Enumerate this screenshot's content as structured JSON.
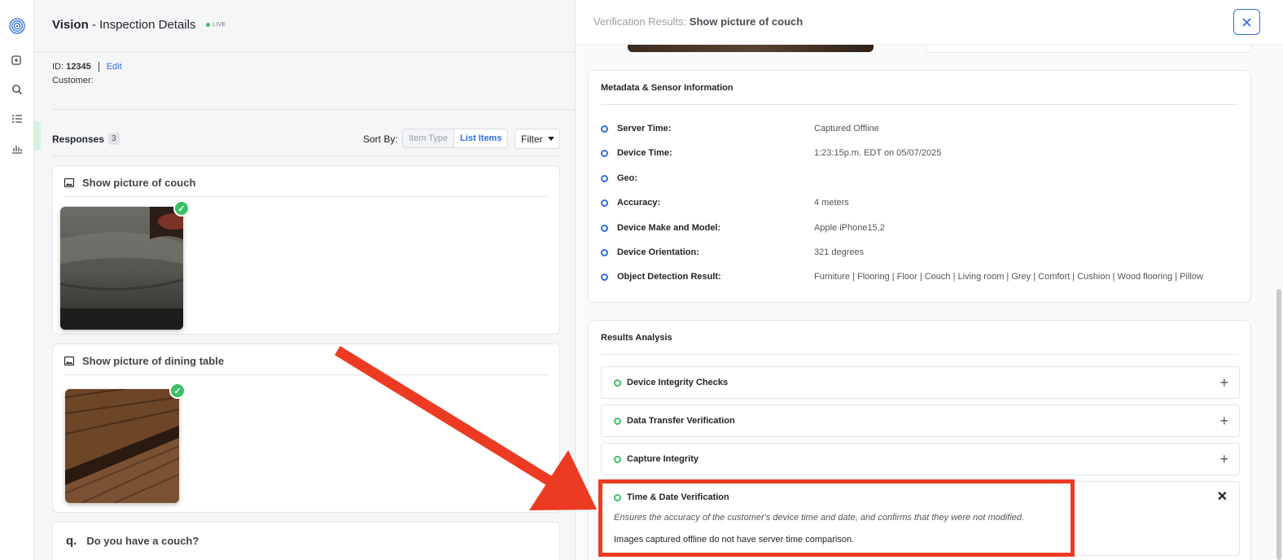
{
  "app": {
    "name": "Vision",
    "page": " - Inspection Details",
    "status": "LIVE"
  },
  "inspection": {
    "id_label": "ID:",
    "id_value": "12345",
    "edit_label": "Edit",
    "customer_label": "Customer:"
  },
  "responses": {
    "label": "Responses",
    "count": "3",
    "sort_label": "Sort By:",
    "sort_options": [
      "Item Type",
      "List Items"
    ],
    "sort_selected": "List Items",
    "filter_label": "Filter",
    "items": [
      {
        "title": "Show picture of couch"
      },
      {
        "title": "Show picture of dining table"
      },
      {
        "prefix": "q.",
        "title": "Do you have a couch?"
      }
    ],
    "check_mark": "✓"
  },
  "panel": {
    "title_prefix": "Verification Results:",
    "title": "Show picture of couch",
    "close_icon": "×",
    "metadata": {
      "heading": "Metadata & Sensor Information",
      "rows": [
        {
          "key": "Server Time:",
          "value": "Captured Offline"
        },
        {
          "key": "Device Time:",
          "value": "1:23:15p.m. EDT on 05/07/2025"
        },
        {
          "key": "Geo:",
          "value": ""
        },
        {
          "key": "Accuracy:",
          "value": "4 meters"
        },
        {
          "key": "Device Make and Model:",
          "value": "Apple iPhone15,2"
        },
        {
          "key": "Device Orientation:",
          "value": "321 degrees"
        },
        {
          "key": "Object Detection Result:",
          "value": "Furniture | Flooring | Floor | Couch | Living room | Grey | Comfort | Cushion | Wood flooring | Pillow"
        }
      ]
    },
    "analysis": {
      "heading": "Results Analysis",
      "items": [
        {
          "label": "Device Integrity Checks",
          "toggle": "+"
        },
        {
          "label": "Data Transfer Verification",
          "toggle": "+"
        },
        {
          "label": "Capture Integrity",
          "toggle": "+"
        },
        {
          "label": "Time & Date Verification",
          "toggle": "✕",
          "description": "Ensures the accuracy of the customer's device time and date, and confirms that they were not modified.",
          "note": "Images captured offline do not have server time comparison."
        }
      ]
    }
  },
  "colors": {
    "accent": "#2f6fe0",
    "success": "#3cbf67",
    "annotation": "#ec3b22"
  }
}
